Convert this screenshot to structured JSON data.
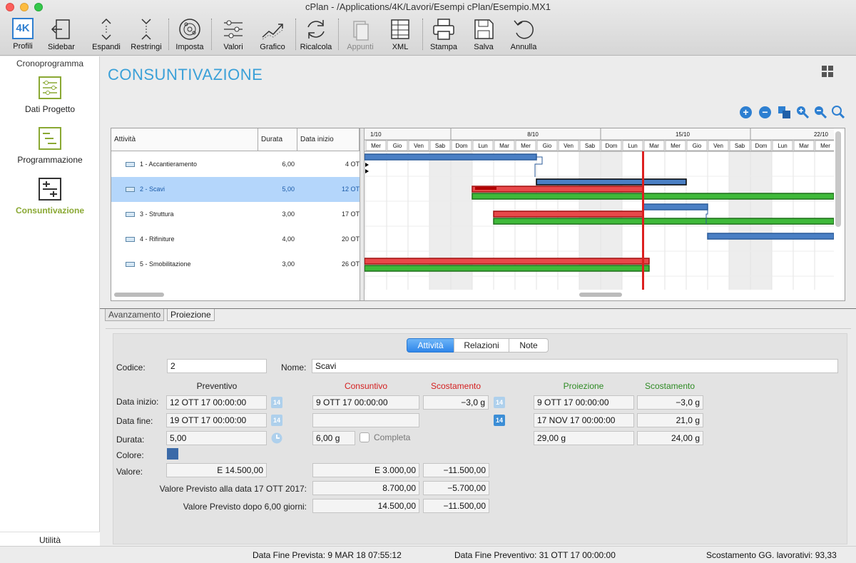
{
  "window": {
    "title": "cPlan - /Applications/4K/Lavori/Esempi cPlan/Esempio.MX1"
  },
  "toolbar": {
    "profili": "Profili",
    "sidebar": "Sidebar",
    "espandi": "Espandi",
    "restringi": "Restringi",
    "imposta": "Imposta",
    "valori": "Valori",
    "grafico": "Grafico",
    "ricalcola": "Ricalcola",
    "appunti": "Appunti",
    "xml": "XML",
    "stampa": "Stampa",
    "salva": "Salva",
    "annulla": "Annulla",
    "logo_text": "4K"
  },
  "sidebar": {
    "header": "Cronoprogramma",
    "items": [
      {
        "label": "Dati Progetto",
        "icon": "sliders-icon"
      },
      {
        "label": "Programmazione",
        "icon": "schedule-icon"
      },
      {
        "label": "Consuntivazione",
        "icon": "progress-icon",
        "active": true
      }
    ],
    "footer": "Utilità"
  },
  "page": {
    "title": "CONSUNTIVAZIONE"
  },
  "table": {
    "columns": {
      "activity": "Attività",
      "duration": "Durata",
      "start": "Data inizio"
    },
    "rows": [
      {
        "name": "1 - Accantieramento",
        "duration": "6,00",
        "start": "4 OT"
      },
      {
        "name": "2 - Scavi",
        "duration": "5,00",
        "start": "12 OT",
        "selected": true
      },
      {
        "name": "3 - Struttura",
        "duration": "3,00",
        "start": "17 OT"
      },
      {
        "name": "4 - Rifiniture",
        "duration": "4,00",
        "start": "20 OT"
      },
      {
        "name": "5 - Smobilitazione",
        "duration": "3,00",
        "start": "26 OT"
      }
    ]
  },
  "gantt": {
    "weeks": [
      "1/10",
      "8/10",
      "15/10",
      "22/10"
    ],
    "days": [
      "Mer",
      "Gio",
      "Ven",
      "Sab",
      "Dom",
      "Lun",
      "Mar",
      "Mer",
      "Gio",
      "Ven",
      "Sab",
      "Dom",
      "Lun",
      "Mar",
      "Mer",
      "Gio",
      "Ven",
      "Sab",
      "Dom",
      "Lun",
      "Mar",
      "Mer"
    ],
    "colors": {
      "planned": "#4a7fc4",
      "actual": "#e8484a",
      "projection": "#3fb93a",
      "today": "#dd1f1f"
    }
  },
  "lower_tabs": {
    "avanzamento": "Avanzamento",
    "proiezione": "Proiezione"
  },
  "detail": {
    "segments": {
      "attivita": "Attività",
      "relazioni": "Relazioni",
      "note": "Note"
    },
    "codice_label": "Codice:",
    "codice": "2",
    "nome_label": "Nome:",
    "nome": "Scavi",
    "headers": {
      "preventivo": "Preventivo",
      "consuntivo": "Consuntivo",
      "scostamento": "Scostamento",
      "proiezione": "Proiezione",
      "scostamento2": "Scostamento"
    },
    "labels": {
      "data_inizio": "Data inizio:",
      "data_fine": "Data fine:",
      "durata": "Durata:",
      "colore": "Colore:",
      "valore": "Valore:",
      "valore_prev_data": "Valore Previsto alla data 17 OTT 2017:",
      "valore_prev_dopo": "Valore Previsto dopo 6,00 giorni:",
      "completa": "Completa"
    },
    "preventivo": {
      "inizio": "12 OTT 17 00:00:00",
      "fine": "19 OTT 17 00:00:00",
      "durata": "5,00",
      "valore": "E  14.500,00"
    },
    "consuntivo": {
      "inizio": "9 OTT 17 00:00:00",
      "fine": "",
      "durata": "6,00 g",
      "valore": "E  3.000,00",
      "prev_data": "8.700,00",
      "prev_dopo": "14.500,00"
    },
    "scostamento": {
      "inizio": "−3,0 g",
      "valore": "−11.500,00",
      "prev_data": "−5.700,00",
      "prev_dopo": "−11.500,00"
    },
    "proiezione": {
      "inizio": "9 OTT 17 00:00:00",
      "fine": "17 NOV 17 00:00:00",
      "durata": "29,00 g"
    },
    "scostamento2": {
      "inizio": "−3,0 g",
      "fine": "21,0 g",
      "durata": "24,00 g"
    },
    "calendar_icon_text": "14",
    "color_swatch": "#3b6aa8"
  },
  "status": {
    "fine_prevista": "Data Fine Prevista: 9 MAR 18 07:55:12",
    "fine_preventivo": "Data Fine Preventivo: 31 OTT 17 00:00:00",
    "scostamento": "Scostamento GG. lavorativi: 93,33"
  }
}
